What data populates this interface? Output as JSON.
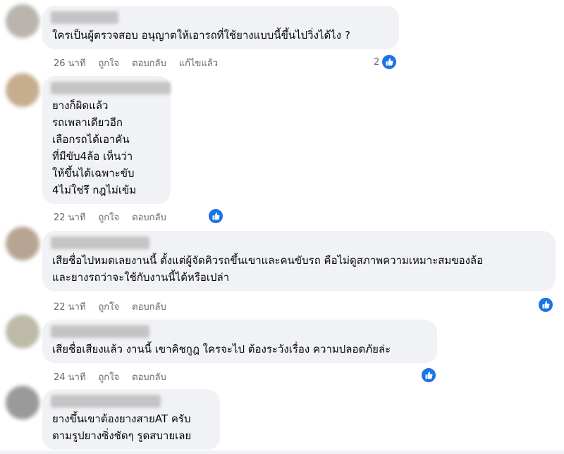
{
  "comments": [
    {
      "lines": [
        "ใครเป็นผู้ตรวจสอบ อนุญาตให้เอารถที่ใช้ยางแบบนี้ขึ้นไปวิ่งได้ไง ?"
      ],
      "time": "26 นาที",
      "like_label": "ถูกใจ",
      "reply_label": "ตอบกลับ",
      "edited_label": "แก้ไขแล้ว",
      "reaction_count": "2"
    },
    {
      "lines": [
        "ยางก็ผิดแล้ว",
        "รถเพลาเดียวอีก",
        "เลือกรถได้เอาคัน",
        "ที่มีขับ4ล้อ เห็นว่า",
        "ให้ขึ้นได้เฉพาะขับ",
        "4ไม่ใช่รึ กฎไม่เข้ม"
      ],
      "time": "22 นาที",
      "like_label": "ถูกใจ",
      "reply_label": "ตอบกลับ"
    },
    {
      "lines": [
        "เสียชื่อไปหมดเลยงานนี้ ตั้งแต่ผู้จัดคิวรถขึ้นเขาและคนขับรถ คือไม่ดูสภาพความเหมาะสมของล้อ",
        "และยางรถว่าจะใช้กับงานนี้ได้หรือเปล่า"
      ],
      "time": "22 นาที",
      "like_label": "ถูกใจ",
      "reply_label": "ตอบกลับ"
    },
    {
      "lines": [
        "เสียชื่อเสียงแล้ว งานนี้ เขาคิชกูฎ ใครจะไป ต้องระวังเรื่อง ความปลอดภัยล่ะ"
      ],
      "time": "24 นาที",
      "like_label": "ถูกใจ",
      "reply_label": "ตอบกลับ"
    },
    {
      "lines": [
        "ยางขึ้นเขาต้องยางสายAT ครับ",
        "ตามรูปยางซิ่งชัดๆ รูดสบายเลย"
      ]
    }
  ],
  "icons": {
    "reaction": "like-thumb-icon"
  },
  "colors": {
    "bubble": "#f0f2f5",
    "like": "#1b74e4",
    "meta": "#65676b"
  }
}
